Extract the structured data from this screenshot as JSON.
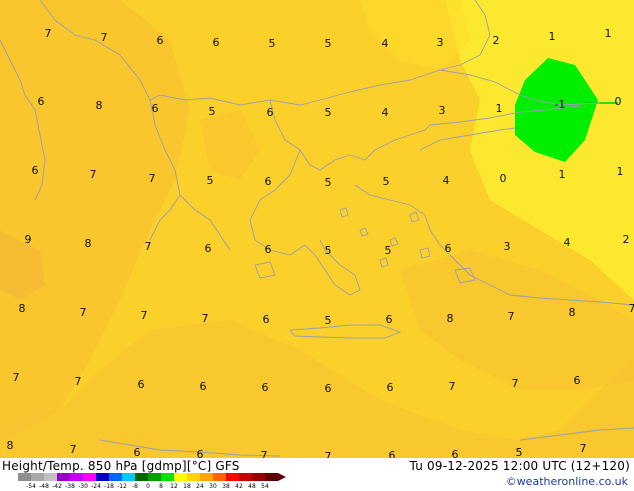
{
  "title_left": "Height/Temp. 850 hPa [gdmp][°C] GFS",
  "title_right": "Tu 09-12-2025 12:00 UTC (12+120)",
  "credit": "©weatheronline.co.uk",
  "colors": {
    "background_main": "#fcd02a",
    "background_dark": "#f8c330",
    "background_light": "#fde830",
    "zero_area": "#00ee00",
    "coastline": "#9aa0b0"
  },
  "temperature_labels": [
    {
      "text": "7"
    },
    {
      "text": "7"
    },
    {
      "text": "6"
    },
    {
      "text": "6"
    },
    {
      "text": "5"
    },
    {
      "text": "5"
    },
    {
      "text": "4"
    },
    {
      "text": "3"
    },
    {
      "text": "2"
    },
    {
      "text": "1"
    },
    {
      "text": "1"
    },
    {
      "text": "6"
    },
    {
      "text": "8"
    },
    {
      "text": "6"
    },
    {
      "text": "5"
    },
    {
      "text": "6"
    },
    {
      "text": "5"
    },
    {
      "text": "4"
    },
    {
      "text": "3"
    },
    {
      "text": "1"
    },
    {
      "text": "-1"
    },
    {
      "text": "0"
    },
    {
      "text": "6"
    },
    {
      "text": "7"
    },
    {
      "text": "7"
    },
    {
      "text": "5"
    },
    {
      "text": "6"
    },
    {
      "text": "5"
    },
    {
      "text": "5"
    },
    {
      "text": "4"
    },
    {
      "text": "0"
    },
    {
      "text": "1"
    },
    {
      "text": "1"
    },
    {
      "text": "9"
    },
    {
      "text": "8"
    },
    {
      "text": "7"
    },
    {
      "text": "6"
    },
    {
      "text": "6"
    },
    {
      "text": "5"
    },
    {
      "text": "5"
    },
    {
      "text": "6"
    },
    {
      "text": "3"
    },
    {
      "text": "4"
    },
    {
      "text": "2"
    },
    {
      "text": "8"
    },
    {
      "text": "7"
    },
    {
      "text": "7"
    },
    {
      "text": "7"
    },
    {
      "text": "6"
    },
    {
      "text": "5"
    },
    {
      "text": "6"
    },
    {
      "text": "8"
    },
    {
      "text": "7"
    },
    {
      "text": "8"
    },
    {
      "text": "7"
    },
    {
      "text": "7"
    },
    {
      "text": "7"
    },
    {
      "text": "6"
    },
    {
      "text": "6"
    },
    {
      "text": "6"
    },
    {
      "text": "6"
    },
    {
      "text": "6"
    },
    {
      "text": "7"
    },
    {
      "text": "7"
    },
    {
      "text": "6"
    },
    {
      "text": "8"
    },
    {
      "text": "7"
    },
    {
      "text": "6"
    },
    {
      "text": "6"
    },
    {
      "text": "7"
    },
    {
      "text": "7"
    },
    {
      "text": "6"
    },
    {
      "text": "6"
    },
    {
      "text": "5"
    },
    {
      "text": "7"
    }
  ],
  "scale": {
    "labels": [
      "-54",
      "-48",
      "-42",
      "-38",
      "-30",
      "-24",
      "-18",
      "-12",
      "-8",
      "0",
      "8",
      "12",
      "18",
      "24",
      "30",
      "38",
      "42",
      "48",
      "54"
    ],
    "colors": [
      "#909090",
      "#a8a8a8",
      "#c0c0c0",
      "#9600c8",
      "#c800ff",
      "#ff00ff",
      "#0000c8",
      "#0064ff",
      "#00c8ff",
      "#006400",
      "#00a000",
      "#00e600",
      "#ffff00",
      "#ffd700",
      "#ffa500",
      "#ff6400",
      "#ff0000",
      "#c80000",
      "#960000",
      "#600000"
    ]
  }
}
